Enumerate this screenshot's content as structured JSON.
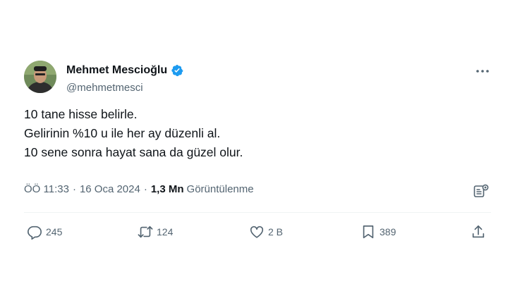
{
  "author": {
    "name": "Mehmet Mescioğlu",
    "handle": "@mehmetmesci"
  },
  "tweet": {
    "lines": [
      "10 tane hisse belirle.",
      "Gelirinin %10 u ile her ay düzenli al.",
      "10 sene sonra hayat sana da güzel olur."
    ]
  },
  "meta": {
    "time": "ÖÖ 11:33",
    "separator": "·",
    "date": "16 Oca 2024",
    "views_count": "1,3 Mn",
    "views_label": "Görüntülenme"
  },
  "actions": {
    "replies": "245",
    "retweets": "124",
    "likes": "2 B",
    "bookmarks": "389"
  },
  "icons": {
    "verified": "verified-badge-icon",
    "more": "more-horizontal-icon",
    "analytics": "analytics-icon",
    "reply": "reply-icon",
    "retweet": "retweet-icon",
    "like": "heart-icon",
    "bookmark": "bookmark-icon",
    "share": "share-icon"
  },
  "colors": {
    "verified": "#1d9bf0",
    "text": "#0f1419",
    "secondary": "#536471"
  }
}
